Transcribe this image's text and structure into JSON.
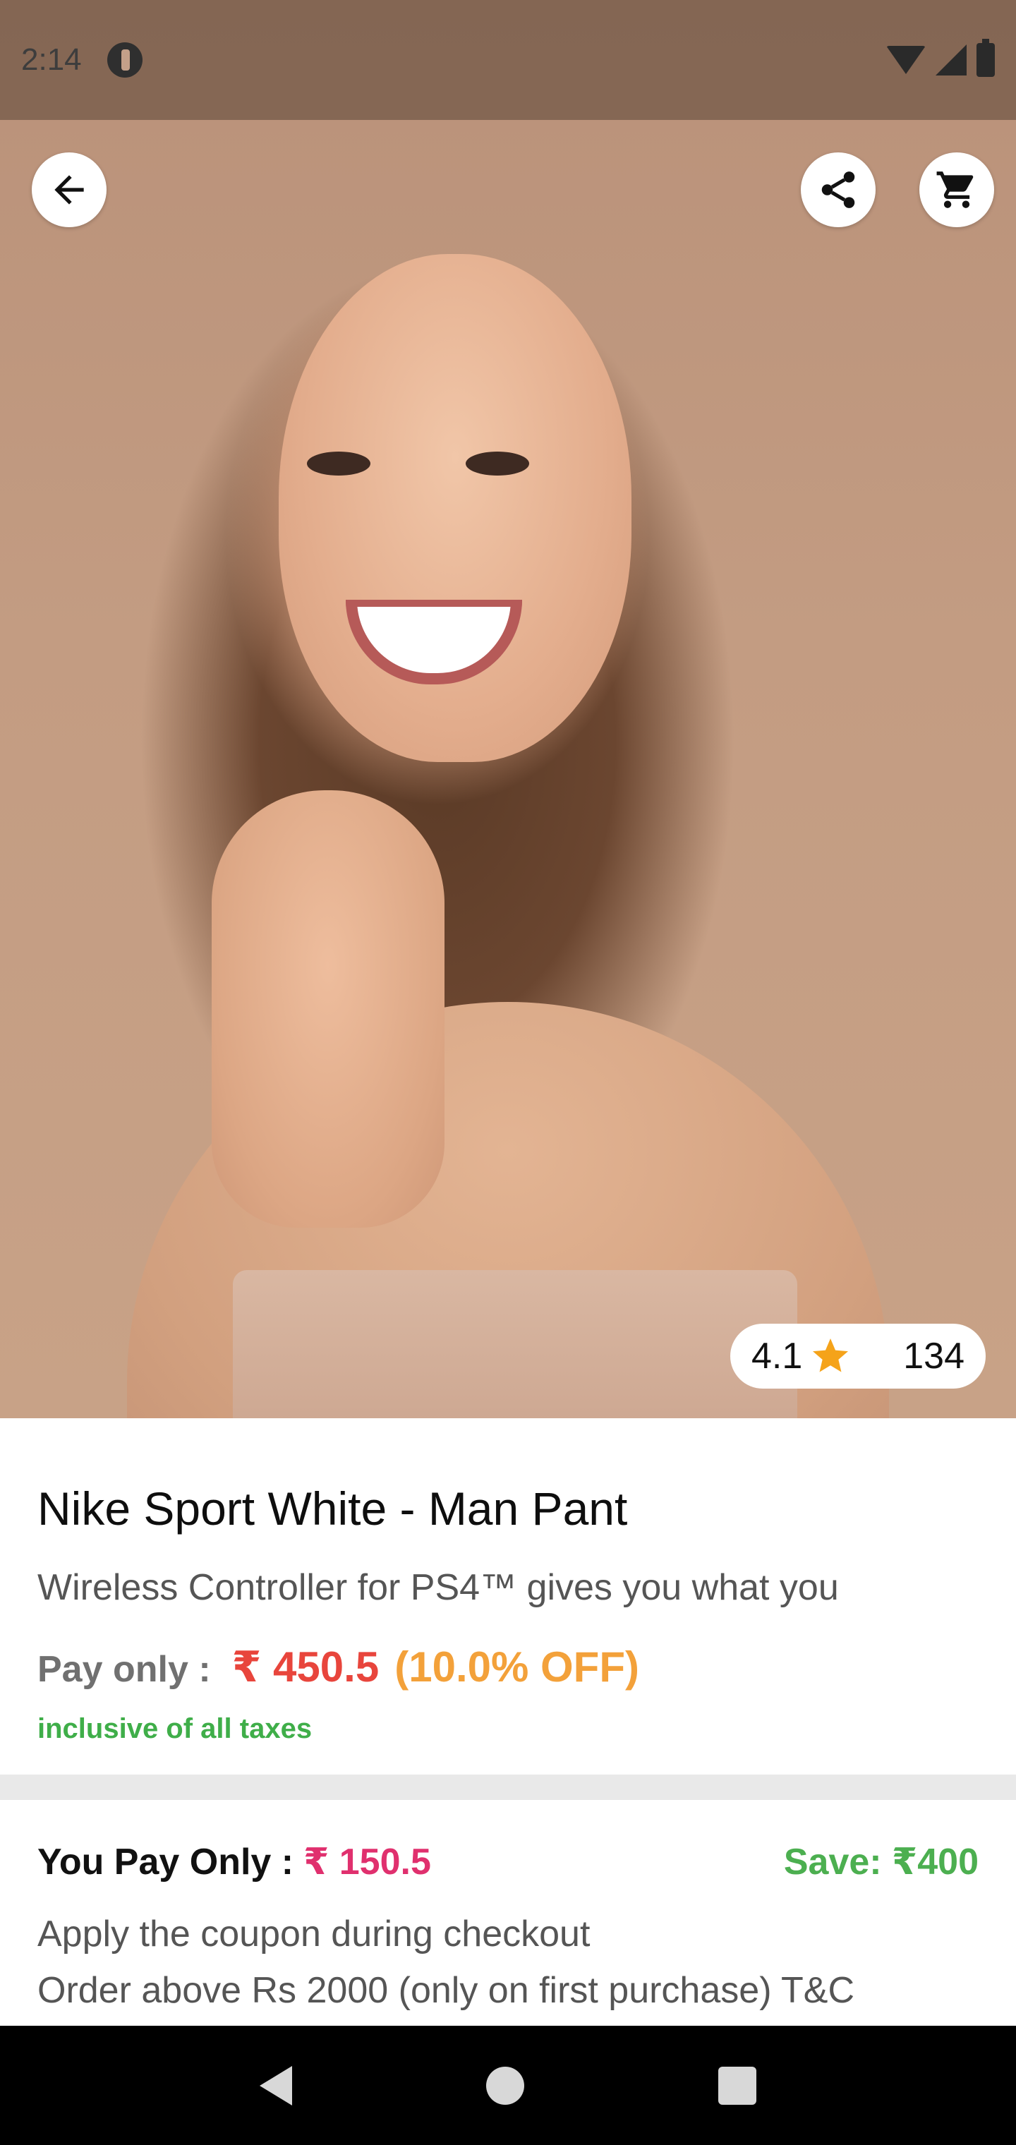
{
  "status_bar": {
    "time": "2:14",
    "icons": [
      "dnd-icon",
      "wifi-icon",
      "signal-icon",
      "battery-icon"
    ]
  },
  "toolbar": {
    "back_icon": "arrow-back-icon",
    "share_icon": "share-icon",
    "cart_icon": "cart-icon"
  },
  "rating": {
    "value": "4.1",
    "star_icon": "star-icon",
    "star_color": "#f5a31a",
    "count": "134"
  },
  "product": {
    "title": "Nike Sport White - Man Pant",
    "description": "Wireless Controller for PS4™ gives you what you",
    "pay_label": "Pay only :",
    "price": "₹ 450.5",
    "discount": "(10.0% OFF)",
    "tax_note": "inclusive of all taxes"
  },
  "coupon": {
    "you_pay_label": "You Pay Only :",
    "you_pay_price": "₹ 150.5",
    "save": "Save: ₹400",
    "line1": "Apply the coupon during checkout",
    "line2": "Order above Rs 2000 (only on first purchase) T&C"
  },
  "colors": {
    "price_red": "#e8453c",
    "discount_orange": "#f3a13a",
    "tax_green": "#3fae49",
    "coupon_pink": "#e0306e",
    "save_green": "#4caf50"
  },
  "nav": {
    "back_icon": "nav-back-icon",
    "home_icon": "nav-home-icon",
    "recents_icon": "nav-recents-icon"
  }
}
